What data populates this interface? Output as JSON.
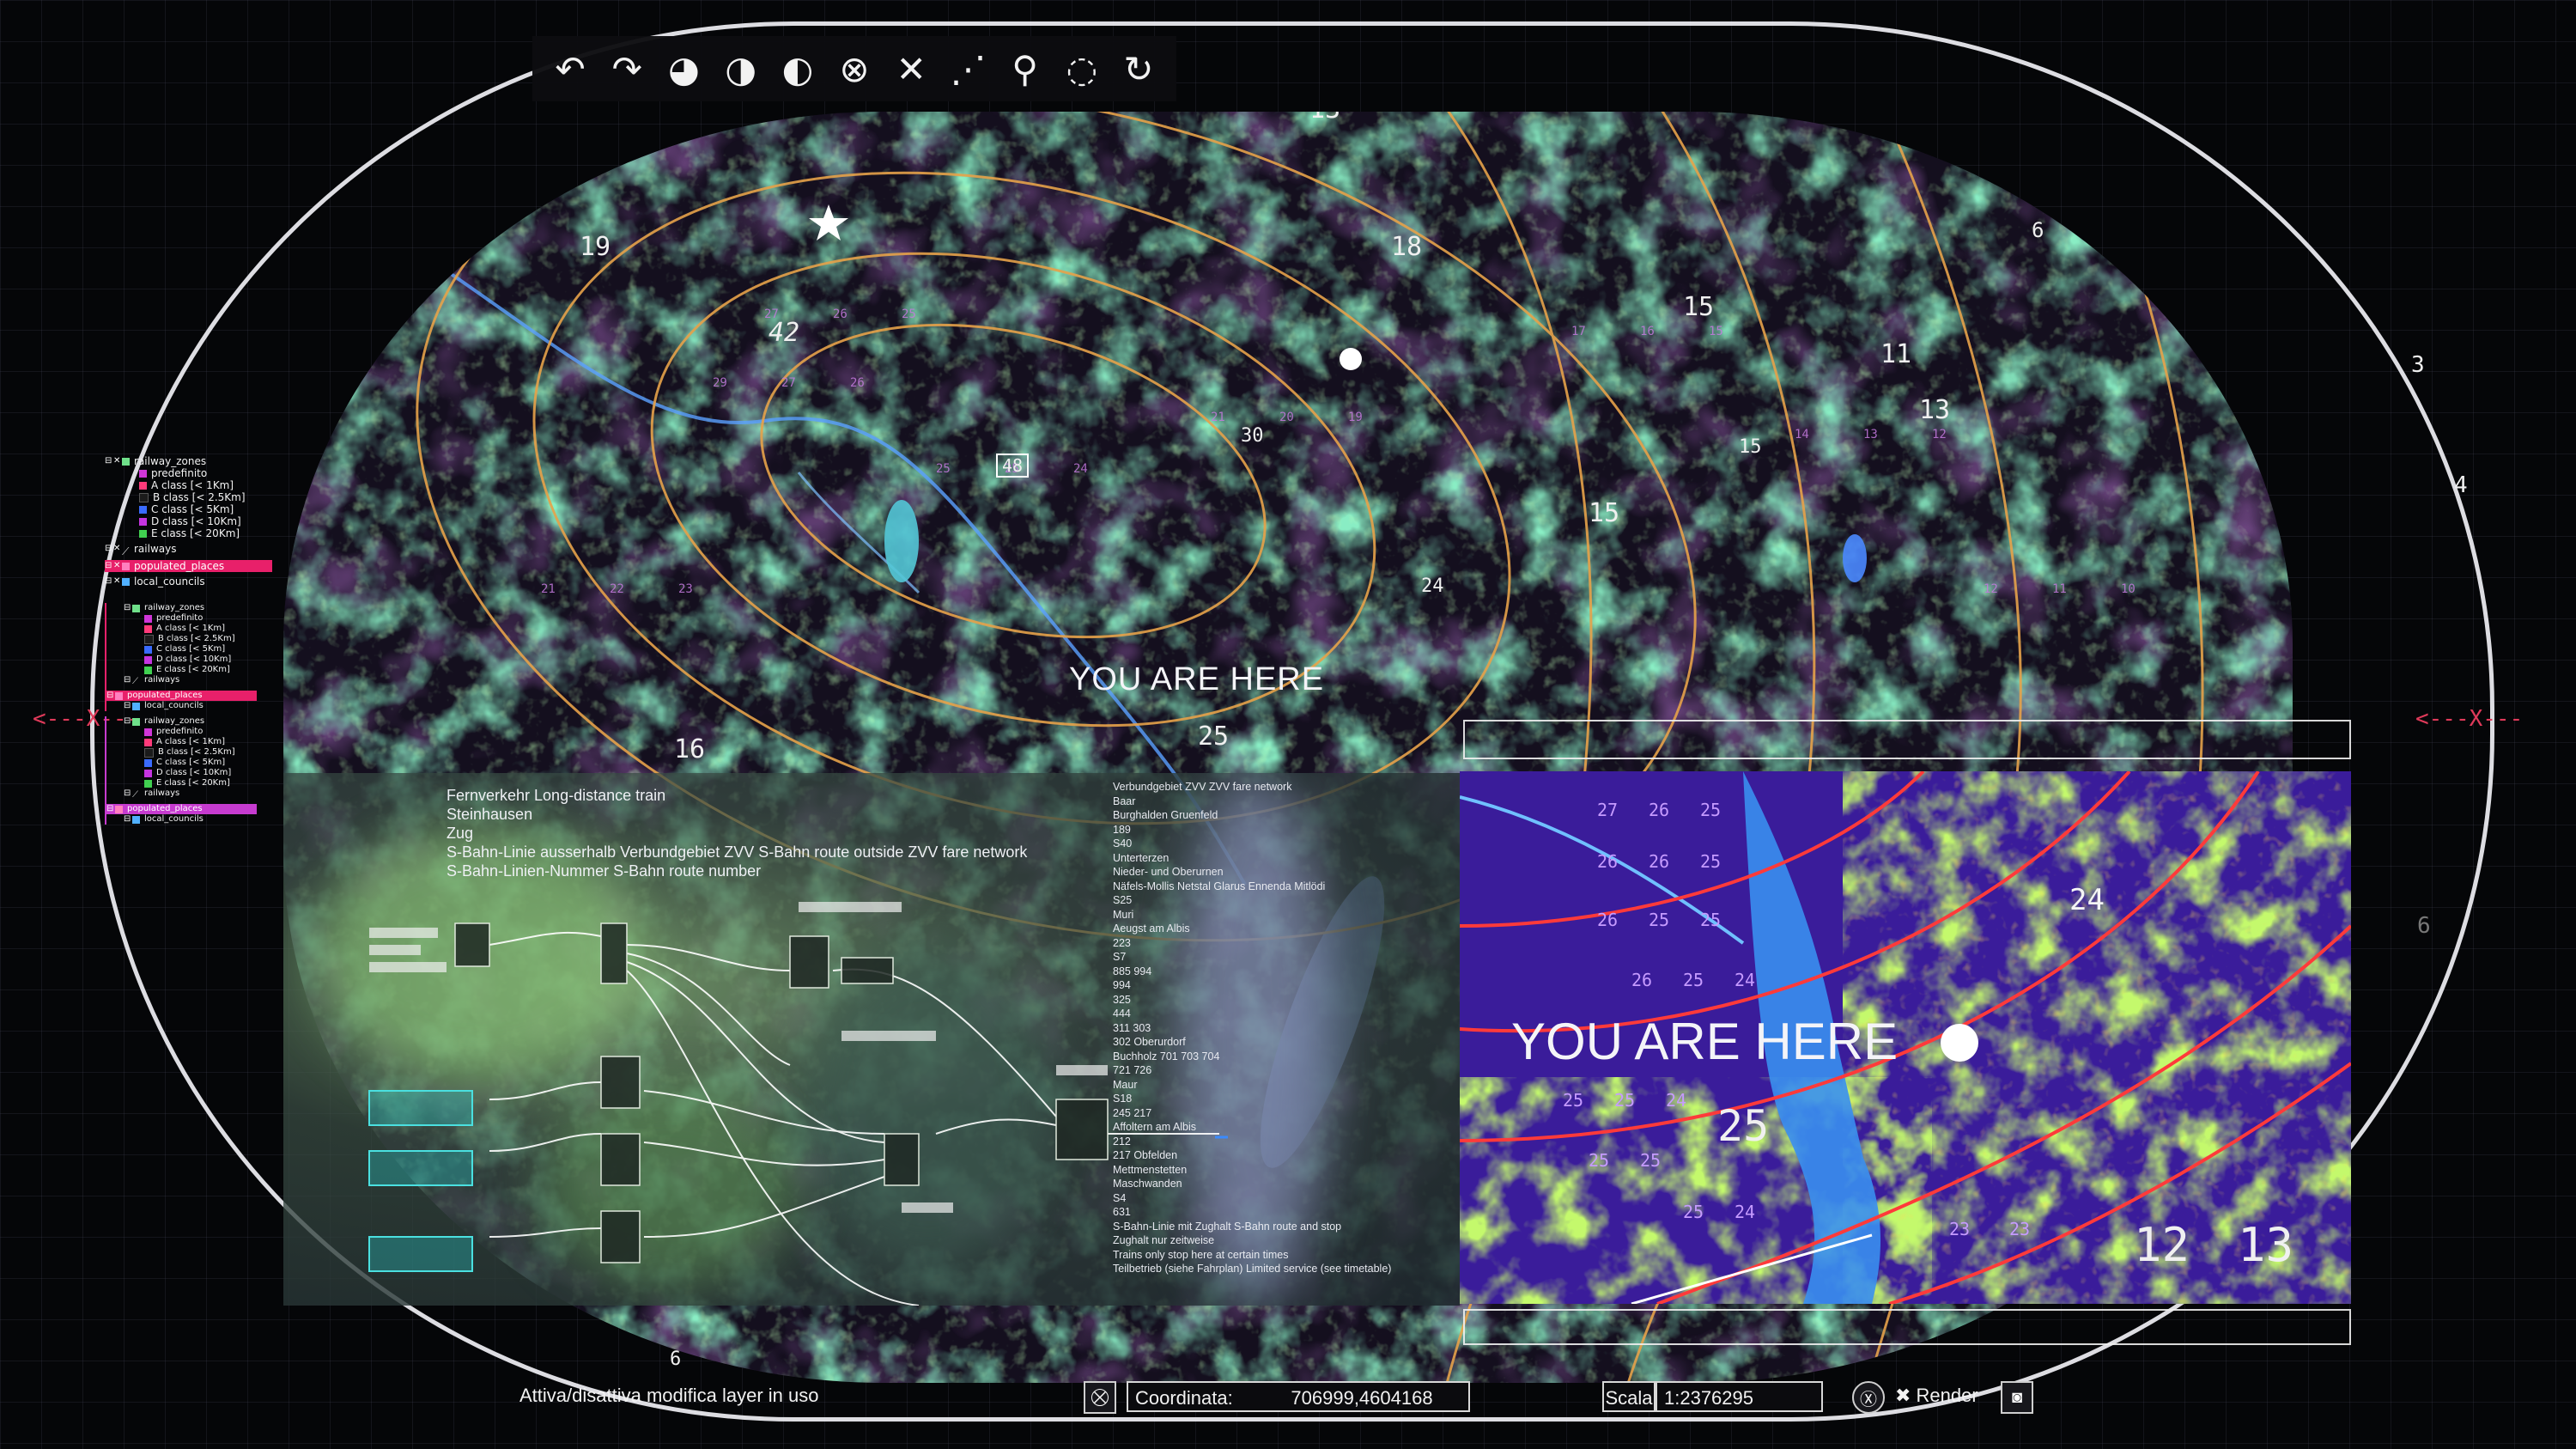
{
  "toolbar": {
    "tools": [
      {
        "name": "undo-icon",
        "glyph": "↶"
      },
      {
        "name": "redo-icon",
        "glyph": "↷"
      },
      {
        "name": "add-layer-icon",
        "glyph": "◕"
      },
      {
        "name": "remove-layer-icon",
        "glyph": "◑"
      },
      {
        "name": "pan-layer-icon",
        "glyph": "◐"
      },
      {
        "name": "delete-feature-icon",
        "glyph": "⊗"
      },
      {
        "name": "clear-selection-icon",
        "glyph": "✕"
      },
      {
        "name": "node-edit-icon",
        "glyph": "⋰"
      },
      {
        "name": "walk-icon",
        "glyph": "⚲"
      },
      {
        "name": "lasso-icon",
        "glyph": "◌"
      },
      {
        "name": "rotate-icon",
        "glyph": "↻"
      }
    ]
  },
  "layer_tree": {
    "group1": {
      "railway_zones": "railway_zones",
      "predefinito": "predefinito",
      "classes": [
        {
          "label": "A class [< 1Km]",
          "color": "#ff3a7a"
        },
        {
          "label": "B class [< 2.5Km]",
          "color": "#1b1b1b"
        },
        {
          "label": "C class [< 5Km]",
          "color": "#3a6bff"
        },
        {
          "label": "D class [< 10Km]",
          "color": "#c534e0"
        },
        {
          "label": "E class [< 20Km]",
          "color": "#40d050"
        }
      ],
      "railways": "railways",
      "populated_places": "populated_places",
      "local_councils": "local_councils"
    },
    "group2": {
      "railway_zones": "railway_zones",
      "predefinito": "predefinito",
      "classes": [
        {
          "label": "A class [< 1Km]",
          "color": "#ff3a7a"
        },
        {
          "label": "B class [< 2.5Km]",
          "color": "#1b1b1b"
        },
        {
          "label": "C class [< 5Km]",
          "color": "#3a6bff"
        },
        {
          "label": "D class [< 10Km]",
          "color": "#c534e0"
        },
        {
          "label": "E class [< 20Km]",
          "color": "#40d050"
        }
      ],
      "railways": "railways",
      "populated_places": "populated_places",
      "local_councils": "local_councils"
    },
    "group3": {
      "railway_zones": "railway_zones",
      "predefinito": "predefinito",
      "classes": [
        {
          "label": "A class [< 1Km]",
          "color": "#ff3a7a"
        },
        {
          "label": "B class [< 2.5Km]",
          "color": "#1b1b1b"
        },
        {
          "label": "C class [< 5Km]",
          "color": "#3a6bff"
        },
        {
          "label": "D class [< 10Km]",
          "color": "#c534e0"
        },
        {
          "label": "E class [< 20Km]",
          "color": "#40d050"
        }
      ],
      "railways": "railways",
      "populated_places": "populated_places",
      "local_councils": "local_councils"
    }
  },
  "map": {
    "contours": [
      "19",
      "42",
      "30",
      "48",
      "18",
      "15",
      "11",
      "13",
      "15",
      "15",
      "24",
      "25",
      "16",
      "13",
      "6",
      "3",
      "4",
      "6",
      "6"
    ],
    "you_are_here": "YOU ARE HERE",
    "here_value": "25"
  },
  "legend_main": [
    "Fernverkehr Long-distance train",
    "Steinhausen",
    "Zug",
    "S-Bahn-Linie ausserhalb Verbundgebiet ZVV S-Bahn route outside ZVV fare network",
    "S-Bahn-Linien-Nummer S-Bahn route number"
  ],
  "legend_right": [
    "Verbundgebiet ZVV ZVV fare network",
    "Baar",
    "Burghalden Gruenfeld",
    "189",
    "S40",
    "Unterterzen",
    "Nieder- und Oberurnen",
    "Näfels-Mollis Netstal Glarus Ennenda Mitlödi",
    "S25",
    "Muri",
    "Aeugst am Albis",
    "223",
    "S7",
    "885 994",
    "994",
    "325",
    "444",
    "311 303",
    "302 Oberurdorf",
    "Buchholz 701 703 704",
    "721 726",
    "Maur",
    "S18",
    "245 217",
    "Affoltern am Albis",
    "212",
    "217 Obfelden",
    "Mettmenstetten",
    "Maschwanden",
    "S4",
    "631",
    "S-Bahn-Linie mit Zughalt S-Bahn route and stop",
    "Zughalt nur zeitweise",
    "Trains only stop here at certain times",
    "Teilbetrieb (siehe Fahrplan) Limited service (see timetable)"
  ],
  "inset": {
    "you_are_here": "YOU ARE HERE",
    "here_value": "25",
    "contour_a": "24",
    "corner_a": "12",
    "corner_b": "13"
  },
  "statusbar": {
    "toggle_label": "Attiva/disattiva modifica layer in uso",
    "coord_label": "Coordinata:",
    "coord_value": "706999,4604168",
    "scale_label": "Scala",
    "scale_value": "1:2376295",
    "render_label": "Render"
  },
  "frame_marker": "<---X---"
}
